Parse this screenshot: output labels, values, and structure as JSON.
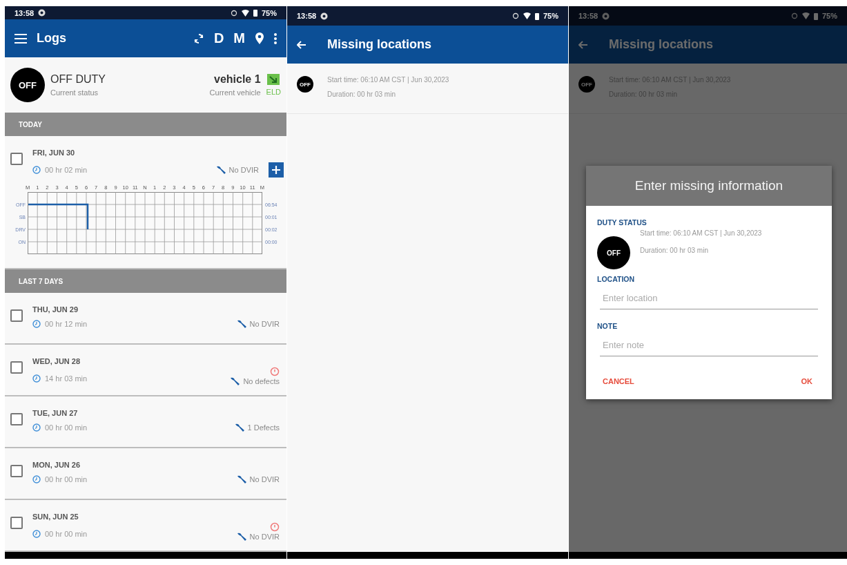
{
  "logs_screen": {
    "status_bar": {
      "time": "13:58",
      "battery": "75%"
    },
    "app_bar": {
      "title": "Logs",
      "actions": [
        "D",
        "M"
      ]
    },
    "current": {
      "badge": "OFF",
      "status": "OFF DUTY",
      "status_caption": "Current status",
      "vehicle": "vehicle 1",
      "vehicle_caption": "Current vehicle",
      "eld": "ELD"
    },
    "today": {
      "header": "TODAY",
      "date": "FRI, JUN 30",
      "duration": "00 hr 02 min",
      "dvir": "No DVIR",
      "checked": false,
      "graph": {
        "hour_labels": [
          "M",
          "1",
          "2",
          "3",
          "4",
          "5",
          "6",
          "7",
          "8",
          "9",
          "10",
          "11",
          "N",
          "1",
          "2",
          "3",
          "4",
          "5",
          "6",
          "7",
          "8",
          "9",
          "10",
          "11",
          "M"
        ],
        "status_labels": [
          "OFF",
          "SB",
          "DRV",
          "ON"
        ],
        "totals": [
          "06:54",
          "00:01",
          "00:02",
          "00:00"
        ]
      }
    },
    "last_days": {
      "header": "LAST 7 DAYS",
      "days": [
        {
          "date": "THU, JUN 29",
          "duration": "00 hr 12 min",
          "dvir": "No DVIR",
          "checked": false,
          "alert": false
        },
        {
          "date": "WED, JUN 28",
          "duration": "14 hr 03 min",
          "dvir": "No defects",
          "checked": false,
          "alert": true
        },
        {
          "date": "TUE, JUN 27",
          "duration": "00 hr 00 min",
          "dvir": "1 Defects",
          "checked": false,
          "alert": false
        },
        {
          "date": "MON, JUN 26",
          "duration": "00 hr 00 min",
          "dvir": "No DVIR",
          "checked": false,
          "alert": false
        },
        {
          "date": "SUN, JUN 25",
          "duration": "00 hr 00 min",
          "dvir": "No DVIR",
          "checked": false,
          "alert": true
        }
      ]
    }
  },
  "missing_locations_screen": {
    "status_bar": {
      "time": "13:58",
      "battery": "75%"
    },
    "title": "Missing locations",
    "entries": [
      {
        "badge": "OFF",
        "start": "Start time: 06:10 AM CST | Jun 30,2023",
        "duration": "Duration: 00 hr 03 min"
      }
    ]
  },
  "dialog_screen": {
    "status_bar": {
      "time": "13:58",
      "battery": "75%"
    },
    "title": "Missing locations",
    "entries": [
      {
        "badge": "OFF",
        "start": "Start time: 06:10 AM CST | Jun 30,2023",
        "duration": "Duration: 00 hr 03 min"
      }
    ],
    "dialog": {
      "title": "Enter missing information",
      "duty_label": "DUTY STATUS",
      "badge": "OFF",
      "start": "Start time: 06:10 AM CST | Jun 30,2023",
      "duration": "Duration: 00 hr 03 min",
      "location_label": "LOCATION",
      "location_placeholder": "Enter location",
      "note_label": "NOTE",
      "note_placeholder": "Enter note",
      "cancel": "CANCEL",
      "ok": "OK"
    }
  }
}
